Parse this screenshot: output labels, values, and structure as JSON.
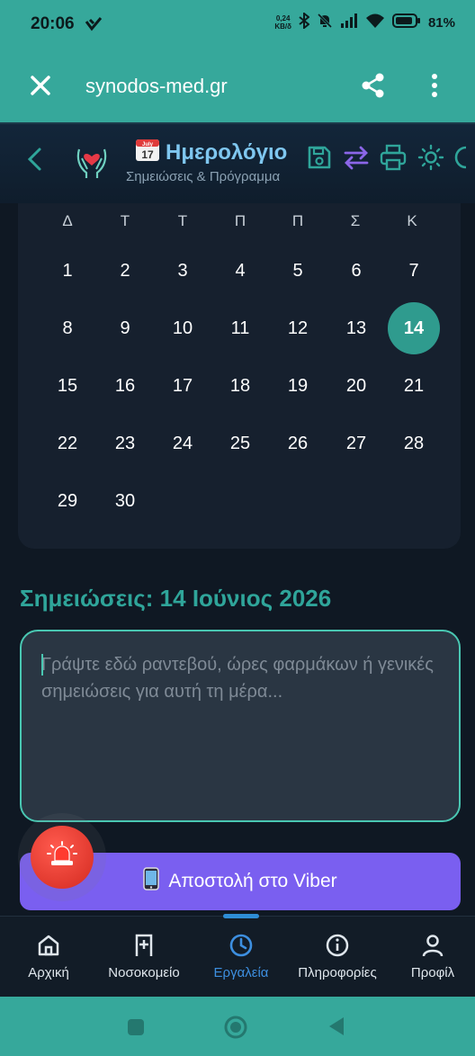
{
  "status_bar": {
    "time": "20:06",
    "net_speed_value": "0,24",
    "net_speed_unit": "KB/δ",
    "battery": "81%",
    "icons": [
      "viber-status-icon",
      "bluetooth-icon",
      "mute-icon",
      "signal-icon",
      "wifi-icon",
      "battery-icon"
    ]
  },
  "browser": {
    "url": "synodos-med.gr",
    "icons": [
      "close-icon",
      "share-icon",
      "more-vert-icon"
    ]
  },
  "header": {
    "title": "Ημερολόγιο",
    "calendar_emoji_month": "July",
    "calendar_emoji_day": "17",
    "subtitle": "Σημειώσεις & Πρόγραμμα",
    "icons": [
      "back-chevron-icon",
      "heart-hands-logo",
      "save-icon",
      "swap-icon",
      "print-icon",
      "sun-icon",
      "moon-icon"
    ]
  },
  "calendar": {
    "weekdays": [
      "Δ",
      "Τ",
      "Τ",
      "Π",
      "Π",
      "Σ",
      "Κ"
    ],
    "weeks": [
      [
        "1",
        "2",
        "3",
        "4",
        "5",
        "6",
        "7"
      ],
      [
        "8",
        "9",
        "10",
        "11",
        "12",
        "13",
        "14"
      ],
      [
        "15",
        "16",
        "17",
        "18",
        "19",
        "20",
        "21"
      ],
      [
        "22",
        "23",
        "24",
        "25",
        "26",
        "27",
        "28"
      ],
      [
        "29",
        "30",
        "",
        "",
        "",
        "",
        ""
      ]
    ],
    "selected_day": "14"
  },
  "notes": {
    "title": "Σημειώσεις: 14 Ιούνιος 2026",
    "placeholder": "Γράψτε εδώ ραντεβού, ώρες φαρμάκων ή γενικές σημειώσεις για αυτή τη μέρα...",
    "value": ""
  },
  "viber_button": {
    "label": "Αποστολή στο Viber"
  },
  "sos_button": {
    "icon": "siren-icon"
  },
  "bottom_nav": {
    "items": [
      {
        "label": "Αρχική",
        "icon": "home-icon",
        "active": false
      },
      {
        "label": "Νοσοκομείο",
        "icon": "hospital-icon",
        "active": false
      },
      {
        "label": "Εργαλεία",
        "icon": "clock-icon",
        "active": true
      },
      {
        "label": "Πληροφορίες",
        "icon": "info-icon",
        "active": false
      },
      {
        "label": "Προφίλ",
        "icon": "profile-icon",
        "active": false
      }
    ]
  },
  "colors": {
    "teal": "#36a89b",
    "accent_teal": "#2f9b8e",
    "viber_purple": "#7a5ff0",
    "sos_red": "#d32a20",
    "active_blue": "#3d8fe0",
    "background": "#0f1823"
  }
}
